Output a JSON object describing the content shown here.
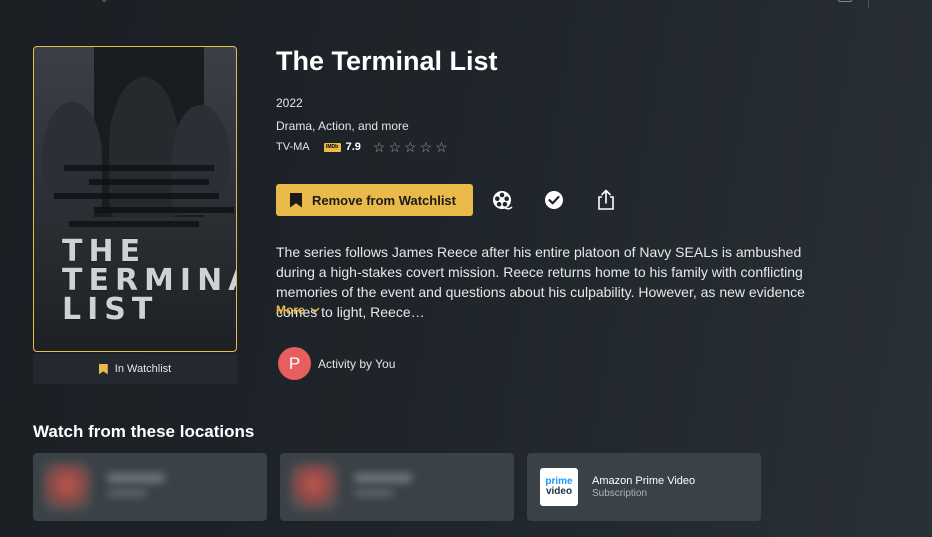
{
  "show": {
    "title": "The Terminal List",
    "year": "2022",
    "genres": "Drama, Action, and more",
    "rating": "TV-MA",
    "imdb_badge": "IMDb",
    "imdb_score": "7.9",
    "user_stars": 0,
    "synopsis": "The series follows James Reece after his entire platoon of Navy SEALs is ambushed during a high-stakes covert mission. Reece returns home to his family with conflicting memories of the event and questions about his culpability. However, as new evidence comes to light, Reece…",
    "more_label": "More"
  },
  "poster": {
    "title_text": "THE TERMINAL LIST"
  },
  "watchlist": {
    "status_label": "In Watchlist",
    "remove_label": "Remove from Watchlist"
  },
  "actions": {
    "icons": [
      "film-reel-icon",
      "check-circle-icon",
      "share-icon"
    ]
  },
  "activity": {
    "avatar_letter": "P",
    "label": "Activity by You"
  },
  "locations": {
    "heading": "Watch from these locations",
    "items": [
      {
        "name": "",
        "sub": "",
        "blurred": true
      },
      {
        "name": "",
        "sub": "",
        "blurred": true
      },
      {
        "name": "Amazon Prime Video",
        "sub": "Subscription",
        "logo_line1": "prime",
        "logo_line2": "video",
        "blurred": false
      }
    ]
  },
  "colors": {
    "accent": "#e9b949",
    "avatar": "#e85d5d",
    "background": "#1e2429",
    "card": "#3b4247"
  }
}
